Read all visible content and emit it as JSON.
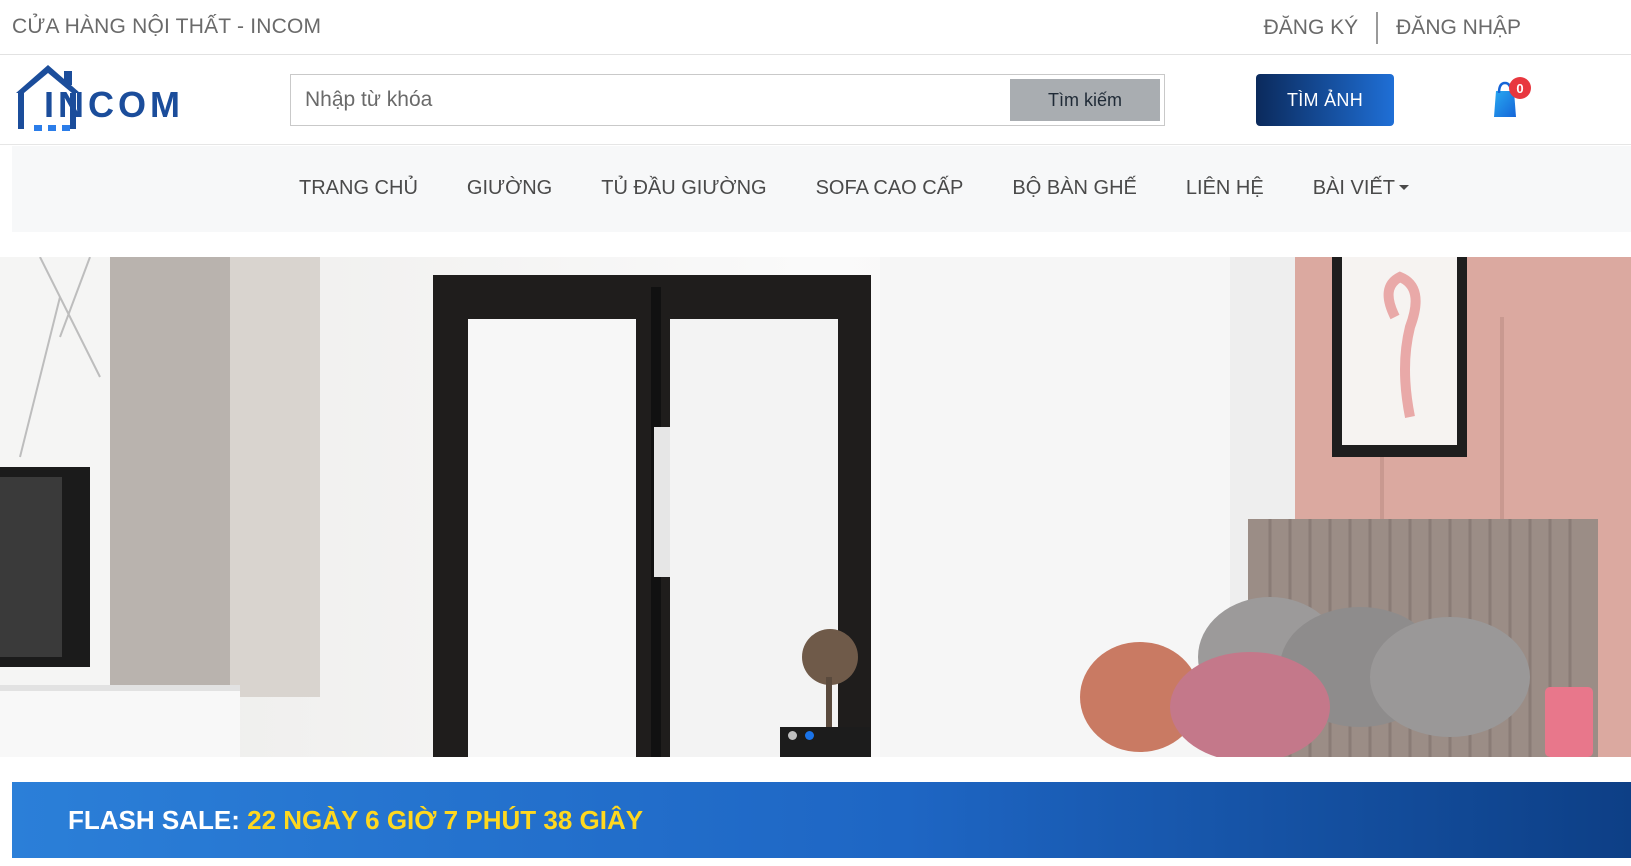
{
  "topbar": {
    "store_name": "CỬA HÀNG NỘI THẤT - INCOM",
    "register": "ĐĂNG KÝ",
    "login": "ĐĂNG NHẬP"
  },
  "header": {
    "logo_text": "INCOM",
    "search_placeholder": "Nhập từ khóa",
    "search_button": "Tìm kiếm",
    "find_image_button": "TÌM ẢNH",
    "cart_count": "0"
  },
  "nav": {
    "items": [
      {
        "label": "TRANG CHỦ"
      },
      {
        "label": "GIƯỜNG"
      },
      {
        "label": "TỦ ĐẦU GIƯỜNG"
      },
      {
        "label": "SOFA CAO CẤP"
      },
      {
        "label": "BỘ BÀN GHẾ"
      },
      {
        "label": "LIÊN HỆ"
      },
      {
        "label": "BÀI VIẾT"
      }
    ]
  },
  "hero": {
    "slide_count": 2,
    "active_slide": 2
  },
  "flash_sale": {
    "label": "FLASH SALE:",
    "countdown": "22 NGÀY 6 GIỜ 7 PHÚT 38 GIÂY"
  },
  "colors": {
    "brand_blue": "#1a73e8",
    "dark_blue": "#0b2a5c",
    "badge_red": "#e8373f",
    "countdown_yellow": "#ffd81f"
  },
  "icons": {
    "logo": "house-logo-icon",
    "cart": "shopping-bag-icon",
    "caret": "caret-down-icon"
  }
}
